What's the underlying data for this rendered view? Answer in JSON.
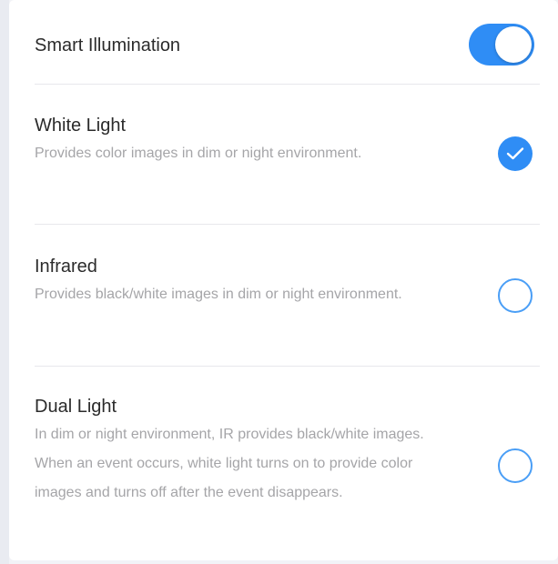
{
  "smart_illumination": {
    "label": "Smart Illumination",
    "enabled": true
  },
  "options": [
    {
      "title": "White Light",
      "description": "Provides color images in dim or night environment.",
      "selected": true
    },
    {
      "title": "Infrared",
      "description": "Provides black/white images in dim or night environment.",
      "selected": false
    },
    {
      "title": "Dual Light",
      "description": "In dim or night environment, IR provides black/white images. When an event occurs, white light turns on to provide color images and turns off after the event disappears.",
      "selected": false
    }
  ],
  "colors": {
    "accent": "#2f8df5",
    "title_text": "#2b2b2b",
    "desc_text": "#a5a5a8"
  },
  "icons": {
    "selected": "checkmark-circle-icon",
    "unselected": "empty-circle-icon"
  }
}
